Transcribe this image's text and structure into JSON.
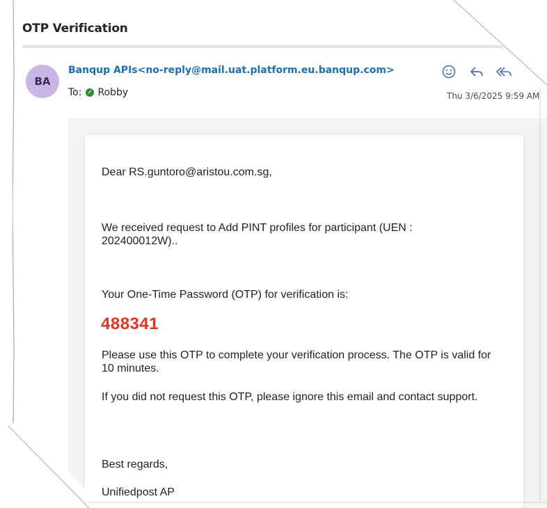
{
  "email": {
    "subject": "OTP Verification",
    "avatar_initials": "BA",
    "sender_name": "Banqup APIs",
    "sender_address": "<no-reply@mail.uat.platform.eu.banqup.com>",
    "to_label": "To:",
    "recipient": "Robby",
    "date": "Thu 3/6/2025 9:59 AM",
    "actions": {
      "react_icon": "smiley-icon",
      "reply_icon": "reply-icon",
      "reply_all_icon": "reply-all-icon"
    }
  },
  "message": {
    "greeting": "Dear RS.guntoro@aristou.com.sg,",
    "request": "We received request to Add PINT profiles for participant (UEN : 202400012W)..",
    "otp_intro": "Your One-Time Password (OTP) for verification is:",
    "otp_code": "488341",
    "validity": "Please use this OTP to complete your verification process. The OTP is valid for 10 minutes.",
    "ignore_note": "If you did not request this OTP, please ignore this email and contact support.",
    "closing": "Best regards,",
    "signature": "Unifiedpost AP"
  },
  "colors": {
    "sender": "#1a6fb5",
    "otp": "#e8331d",
    "avatar": "#c9b6e4"
  }
}
